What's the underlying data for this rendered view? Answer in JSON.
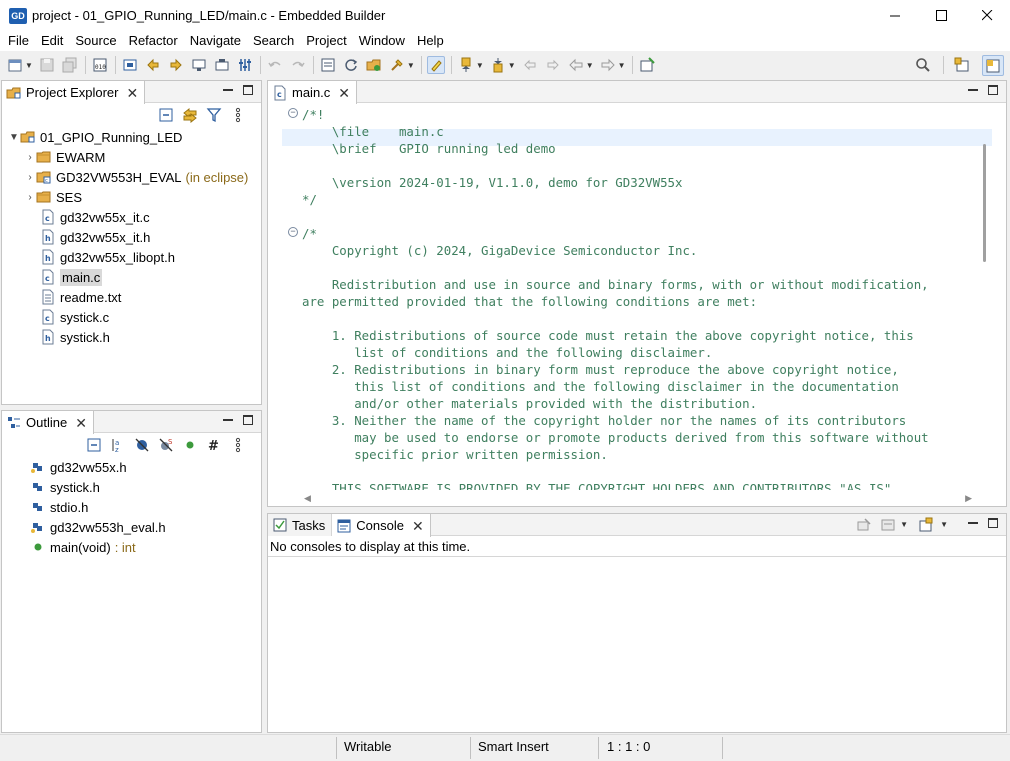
{
  "window": {
    "logo_text": "GD",
    "title": "project - 01_GPIO_Running_LED/main.c - Embedded Builder"
  },
  "menu": [
    "File",
    "Edit",
    "Source",
    "Refactor",
    "Navigate",
    "Search",
    "Project",
    "Window",
    "Help"
  ],
  "explorer": {
    "tab_label": "Project Explorer",
    "tree": [
      {
        "label": "01_GPIO_Running_LED",
        "decoration": "",
        "icon": "project-folder-icon"
      },
      {
        "label": "EWARM",
        "decoration": "",
        "icon": "folder-icon"
      },
      {
        "label": "GD32VW553H_EVAL",
        "decoration": "(in eclipse)",
        "icon": "linked-folder-icon"
      },
      {
        "label": "SES",
        "decoration": "",
        "icon": "folder-icon"
      },
      {
        "label": "gd32vw55x_it.c",
        "decoration": "",
        "icon": "c-file-icon"
      },
      {
        "label": "gd32vw55x_it.h",
        "decoration": "",
        "icon": "h-file-icon"
      },
      {
        "label": "gd32vw55x_libopt.h",
        "decoration": "",
        "icon": "h-file-icon"
      },
      {
        "label": "main.c",
        "decoration": "",
        "icon": "c-file-icon"
      },
      {
        "label": "readme.txt",
        "decoration": "",
        "icon": "text-file-icon"
      },
      {
        "label": "systick.c",
        "decoration": "",
        "icon": "c-file-icon"
      },
      {
        "label": "systick.h",
        "decoration": "",
        "icon": "h-file-icon"
      }
    ]
  },
  "outline": {
    "tab_label": "Outline",
    "items": [
      {
        "label": "gd32vw55x.h",
        "type": ""
      },
      {
        "label": "systick.h",
        "type": ""
      },
      {
        "label": "stdio.h",
        "type": ""
      },
      {
        "label": "gd32vw553h_eval.h",
        "type": ""
      },
      {
        "label": "main(void)",
        "type": ": int"
      }
    ]
  },
  "editor": {
    "tab_label": "main.c",
    "lines": [
      "/*!",
      "    \\file    main.c",
      "    \\brief   GPIO running led demo",
      "",
      "    \\version 2024-01-19, V1.1.0, demo for GD32VW55x",
      "*/",
      "",
      "/*",
      "    Copyright (c) 2024, GigaDevice Semiconductor Inc.",
      "",
      "    Redistribution and use in source and binary forms, with or without modification,",
      "are permitted provided that the following conditions are met:",
      "",
      "    1. Redistributions of source code must retain the above copyright notice, this",
      "       list of conditions and the following disclaimer.",
      "    2. Redistributions in binary form must reproduce the above copyright notice,",
      "       this list of conditions and the following disclaimer in the documentation",
      "       and/or other materials provided with the distribution.",
      "    3. Neither the name of the copyright holder nor the names of its contributors",
      "       may be used to endorse or promote products derived from this software without",
      "       specific prior written permission.",
      "",
      "    THIS SOFTWARE IS PROVIDED BY THE COPYRIGHT HOLDERS AND CONTRIBUTORS \"AS IS\""
    ]
  },
  "bottom": {
    "tasks_label": "Tasks",
    "console_label": "Console",
    "console_message": "No consoles to display at this time."
  },
  "status": {
    "writable": "Writable",
    "insert_mode": "Smart Insert",
    "position": "1 : 1 : 0"
  },
  "colors": {
    "comment": "#3f7f5f",
    "current_line": "#e8f2fe",
    "folder": "#e7b04a",
    "accent": "#1f5fb0"
  }
}
